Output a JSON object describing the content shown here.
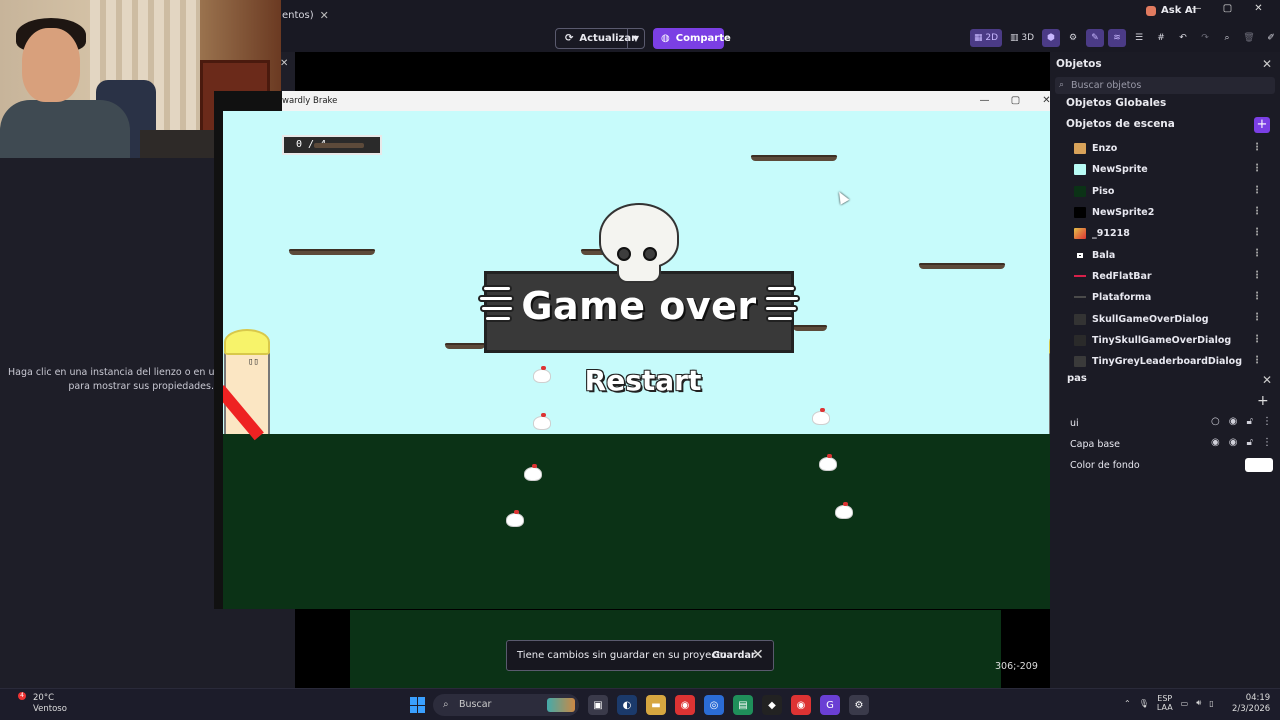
{
  "app": {
    "tab_fragment": "entos)",
    "ask_ai": "Ask AI",
    "update_label": "Actualizar",
    "share_label": "Comparte",
    "view_2d": "2D",
    "view_3d": "3D"
  },
  "properties_hint": {
    "line1": "Haga clic en una instancia del lienzo o en un o",
    "line2": "para mostrar sus propiedades."
  },
  "objects_panel": {
    "title": "Objetos",
    "search_placeholder": "Buscar objetos",
    "global_section": "Objetos Globales",
    "scene_section": "Objetos de escena",
    "items": [
      {
        "label": "Enzo",
        "color": "#d9a35a"
      },
      {
        "label": "NewSprite",
        "color": "#b8fbf5"
      },
      {
        "label": "Piso",
        "color": "#0b3216"
      },
      {
        "label": "NewSprite2",
        "color": "#000000"
      },
      {
        "label": "_91218",
        "color": "#e4c04a"
      },
      {
        "label": "Bala",
        "color": "#ffffff"
      },
      {
        "label": "RedFlatBar",
        "color": "#d8204a"
      },
      {
        "label": "Plataforma",
        "color": "#4a4a4a"
      },
      {
        "label": "SkullGameOverDialog",
        "color": "#333333"
      },
      {
        "label": "TinySkullGameOverDialog",
        "color": "#2a2a2a"
      },
      {
        "label": "TinyGreyLeaderboardDialog",
        "color": "#3a3a3a"
      }
    ]
  },
  "layers_panel": {
    "title": "pas",
    "layers": [
      {
        "label": "ui"
      },
      {
        "label": "Capa base"
      }
    ],
    "background_label": "Color de fondo",
    "background_color": "#ffffff"
  },
  "game_window": {
    "title": "wardly Brake",
    "counter": "0 / 4",
    "game_over_text": "Game over",
    "restart_label": "Restart"
  },
  "canvas": {
    "coordinates": "306;-209"
  },
  "toast": {
    "message": "Tiene cambios sin guardar en su proyecto.",
    "save_label": "Guardar"
  },
  "taskbar": {
    "temperature": "20°C",
    "weather": "Ventoso",
    "notification_count": "4",
    "search_label": "Buscar",
    "lang_top": "ESP",
    "lang_bottom": "LAA",
    "time": "04:19",
    "date": "2/3/2026"
  }
}
